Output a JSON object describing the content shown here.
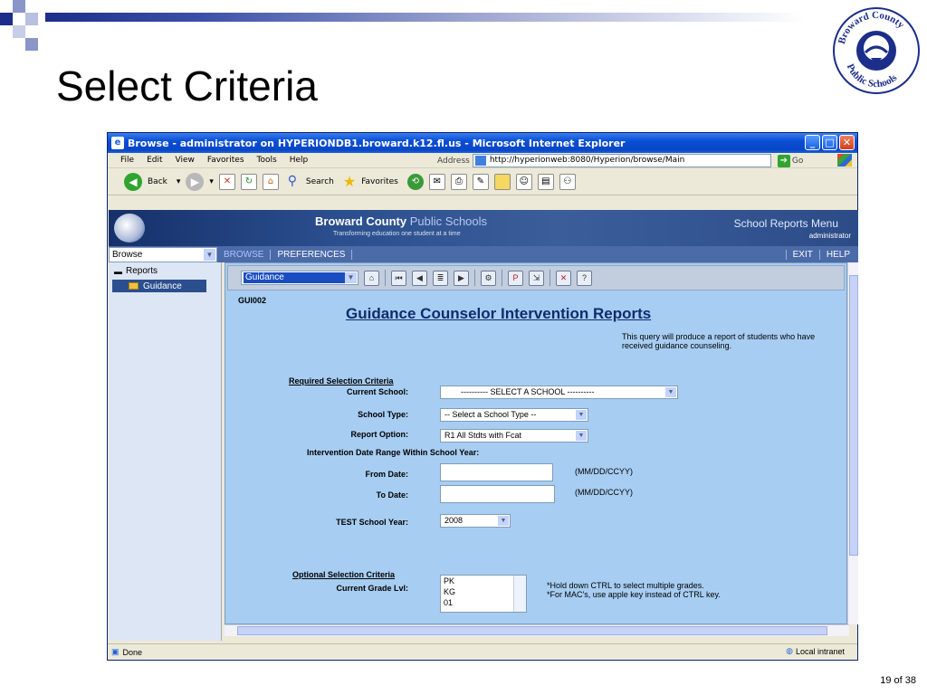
{
  "slide": {
    "title": "Select Criteria",
    "page_number": "19 of 38"
  },
  "logo": {
    "text_top": "Broward County",
    "text_bottom": "Public Schools"
  },
  "window": {
    "title": "Browse - administrator on HYPERIONDB1.broward.k12.fl.us - Microsoft Internet Explorer",
    "menu": [
      "File",
      "Edit",
      "View",
      "Favorites",
      "Tools",
      "Help"
    ],
    "address_label": "Address",
    "address_url": "http://hyperionweb:8080/Hyperion/browse/Main",
    "go_label": "Go",
    "toolbar": {
      "back": "Back",
      "search": "Search",
      "favorites": "Favorites"
    },
    "status_left": "Done",
    "status_zone": "Local intranet"
  },
  "banner": {
    "title_bold": "Broward County",
    "title_light": "Public Schools",
    "tagline": "Transforming education one student at a time",
    "menu_title": "School Reports Menu",
    "user": "administrator"
  },
  "navbar": {
    "select_value": "Browse",
    "items": [
      "BROWSE",
      "PREFERENCES"
    ],
    "right_items": [
      "EXIT",
      "HELP"
    ]
  },
  "sidebar": {
    "root": "Reports",
    "child": "Guidance"
  },
  "report": {
    "toolbar_select": "Guidance",
    "code": "GUI002",
    "title": "Guidance Counselor Intervention Reports",
    "description": "This query will produce a report of students who have received guidance counseling.",
    "required_header": "Required Selection Criteria",
    "fields": {
      "current_school_label": "Current School:",
      "current_school_value": "---------- SELECT A SCHOOL ----------",
      "school_type_label": "School Type:",
      "school_type_value": "-- Select a School Type --",
      "report_option_label": "Report Option:",
      "report_option_value": "R1 All Stdts with Fcat",
      "date_range_label": "Intervention Date Range Within School Year:",
      "from_date_label": "From Date:",
      "to_date_label": "To Date:",
      "date_format": "(MM/DD/CCYY)",
      "test_year_label": "TEST School Year:",
      "test_year_value": "2008"
    },
    "optional_header": "Optional Selection Criteria",
    "grade_label": "Current Grade Lvl:",
    "grade_options": [
      "PK",
      "KG",
      "01"
    ],
    "grade_note_1": "*Hold down CTRL to select multiple grades.",
    "grade_note_2": "*For MAC's, use apple key instead of CTRL key."
  }
}
